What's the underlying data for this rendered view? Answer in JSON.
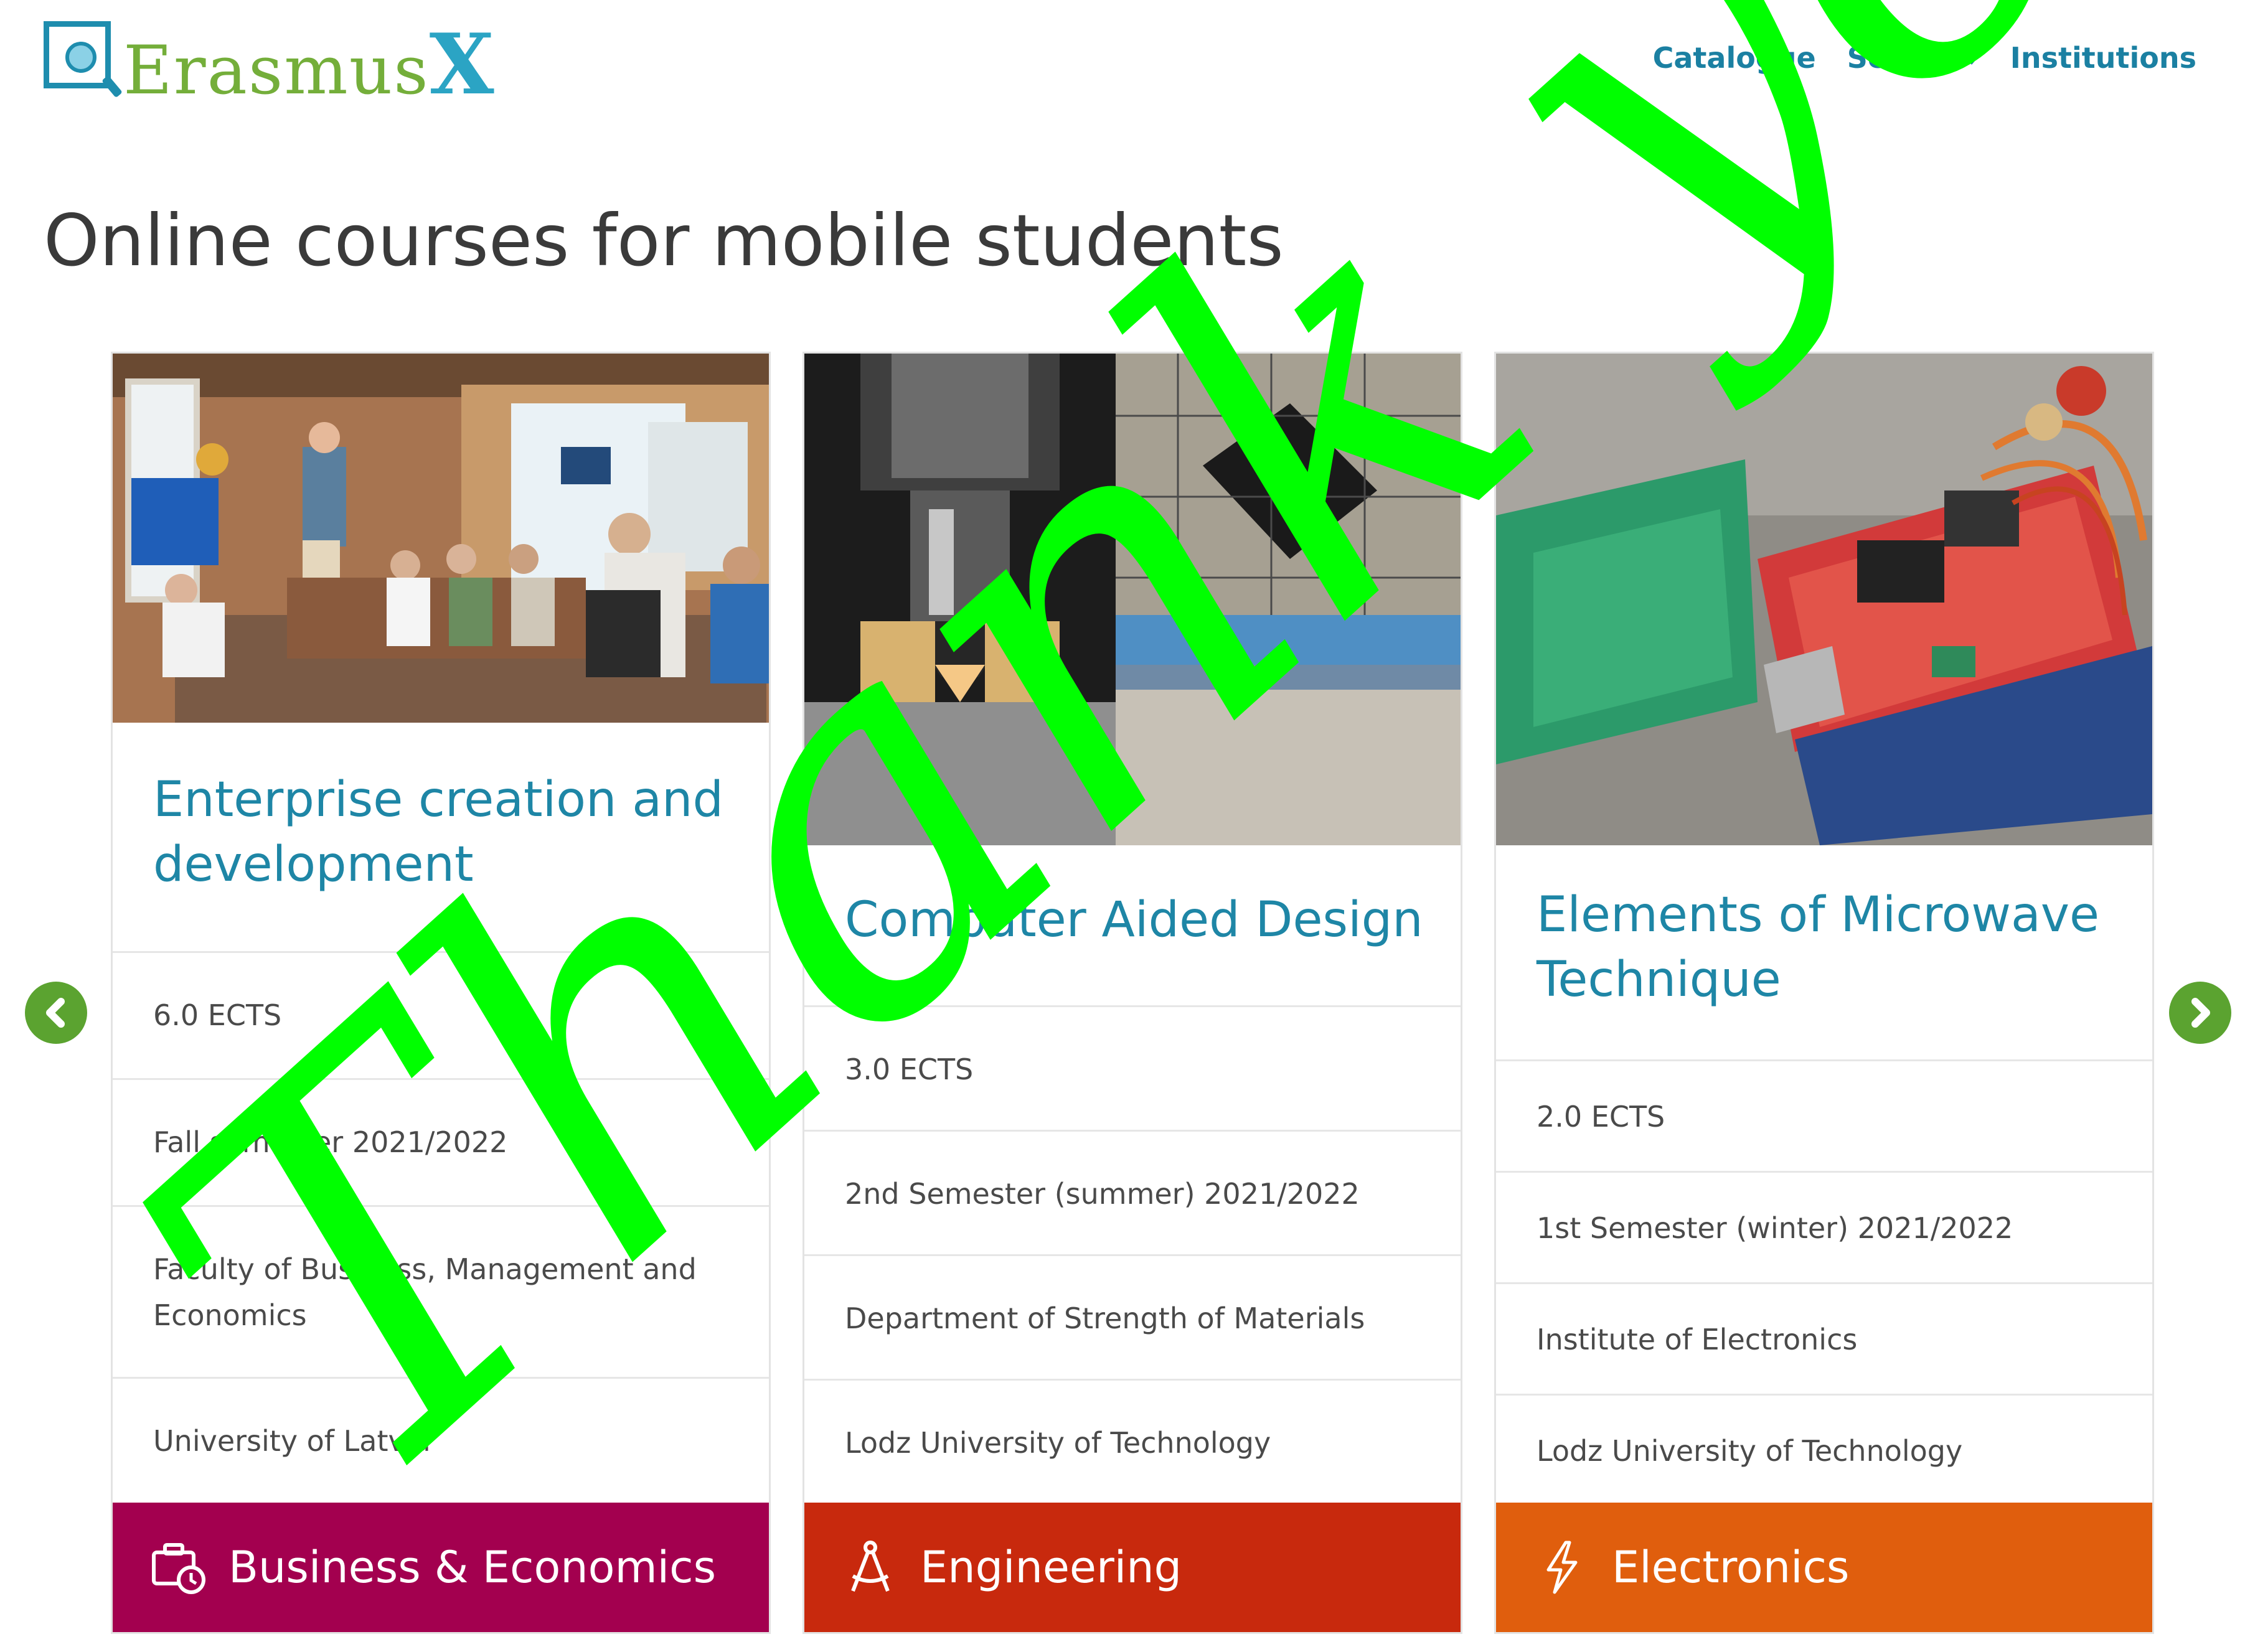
{
  "brand": {
    "name": "Erasmus",
    "x": "X"
  },
  "nav": {
    "catalogue": "Catalogue",
    "search": "Search",
    "institutions": "Institutions"
  },
  "page": {
    "title": "Online courses for mobile students"
  },
  "carousel": {
    "prev_icon": "chevron-left-icon",
    "next_icon": "chevron-right-icon",
    "arrow_color": "#5ba330",
    "cards": [
      {
        "title": "Enterprise creation and development",
        "ects": "6.0 ECTS",
        "semester": "Fall semester 2021/2022",
        "faculty": "Faculty of Business, Management and Economics",
        "university": "University of Latvia",
        "category": "Business & Economics",
        "category_icon": "briefcase-clock-icon",
        "category_color": "#a3004f"
      },
      {
        "title": "Computer Aided Design",
        "ects": "3.0 ECTS",
        "semester": "2nd Semester (summer) 2021/2022",
        "faculty": "Department of Strength of Materials",
        "university": "Lodz University of Technology",
        "category": "Engineering",
        "category_icon": "compass-icon",
        "category_color": "#c8290d"
      },
      {
        "title": "Elements of Microwave Technique",
        "ects": "2.0 ECTS",
        "semester": "1st Semester (winter) 2021/2022",
        "faculty": "Institute of Electronics",
        "university": "Lodz University of Technology",
        "category": "Electronics",
        "category_icon": "lightning-icon",
        "category_color": "#e05e0d"
      }
    ]
  },
  "overlay": {
    "text": "Thank you!",
    "color": "#00ff00"
  }
}
